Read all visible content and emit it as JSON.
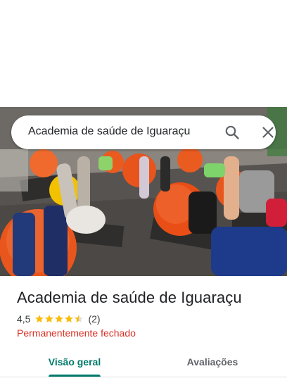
{
  "search": {
    "query": "Academia de saúde de Iguaraçu"
  },
  "hero": {
    "image_icon": "gym-exercise-photo"
  },
  "place": {
    "title": "Academia de saúde de Iguaraçu",
    "rating_value": "4,5",
    "rating": 4.5,
    "stars_max": 5,
    "review_count": "(2)",
    "status": "Permanentemente fechado"
  },
  "tabs": [
    {
      "label": "Visão geral",
      "active": true
    },
    {
      "label": "Avaliações",
      "active": false
    }
  ],
  "colors": {
    "accent": "#00796b",
    "star": "#fbbc04",
    "closed": "#d93025"
  },
  "icons": {
    "search": "search-icon",
    "close": "close-icon"
  }
}
